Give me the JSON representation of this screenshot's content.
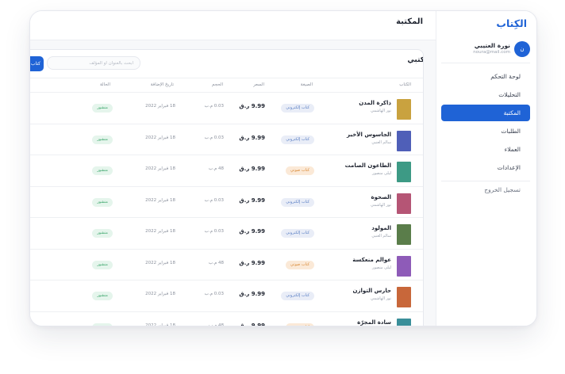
{
  "sidebar": {
    "logo": "الكِتاب",
    "profile": {
      "avatar_initial": "ن",
      "name": "نورة العتيبي",
      "email": "noura@mail.com"
    },
    "nav": [
      {
        "label": "لوحة التحكم",
        "active": false
      },
      {
        "label": "التحليلات",
        "active": false
      },
      {
        "label": "المكتبة",
        "active": true
      },
      {
        "label": "الطلبات",
        "active": false
      },
      {
        "label": "العملاء",
        "active": false
      },
      {
        "label": "الإعدادات",
        "active": false
      }
    ],
    "logout": "تسجيل الخروج"
  },
  "header": {
    "title": "المكتبة"
  },
  "library": {
    "title": "كتبي",
    "search_placeholder": "ابحث بالعنوان أو المؤلف",
    "add_button": "+ كتاب",
    "columns": {
      "book": "الكتاب",
      "format": "الصيغة",
      "price": "السعر",
      "size": "الحجم",
      "date": "تاريخ الإضافة",
      "status": "الحالة"
    },
    "rows": [
      {
        "title": "ذاكرة المدن",
        "author": "نور الهاشمي",
        "format": "كتاب إلكتروني",
        "format_type": "ebook",
        "price": "9.99 ر.ق",
        "size": "0.03 م.ب",
        "date": "18 فبراير 2022",
        "status": "منشور",
        "cover": "#c9a23f"
      },
      {
        "title": "الجاسوس الأخير",
        "author": "سالم العنبي",
        "format": "كتاب إلكتروني",
        "format_type": "ebook",
        "price": "9.99 ر.ق",
        "size": "0.03 م.ب",
        "date": "18 فبراير 2022",
        "status": "منشور",
        "cover": "#4f5fb8"
      },
      {
        "title": "الطاعون الصامت",
        "author": "ليلى منصور",
        "format": "كتاب صوتي",
        "format_type": "audio",
        "price": "9.99 ر.ق",
        "size": "48 م.ب",
        "date": "18 فبراير 2022",
        "status": "منشور",
        "cover": "#3d9a85"
      },
      {
        "title": "الصحوة",
        "author": "نور الهاشمي",
        "format": "كتاب إلكتروني",
        "format_type": "ebook",
        "price": "9.99 ر.ق",
        "size": "0.03 م.ب",
        "date": "18 فبراير 2022",
        "status": "منشور",
        "cover": "#b55575"
      },
      {
        "title": "المولود",
        "author": "سالم العنبي",
        "format": "كتاب إلكتروني",
        "format_type": "ebook",
        "price": "9.99 ر.ق",
        "size": "0.03 م.ب",
        "date": "18 فبراير 2022",
        "status": "منشور",
        "cover": "#5a7d4a"
      },
      {
        "title": "عوالم منعكسة",
        "author": "ليلى منصور",
        "format": "كتاب صوتي",
        "format_type": "audio",
        "price": "9.99 ر.ق",
        "size": "48 م.ب",
        "date": "18 فبراير 2022",
        "status": "منشور",
        "cover": "#8e5bb8"
      },
      {
        "title": "حارس التوازن",
        "author": "نور الهاشمي",
        "format": "كتاب إلكتروني",
        "format_type": "ebook",
        "price": "9.99 ر.ق",
        "size": "0.03 م.ب",
        "date": "18 فبراير 2022",
        "status": "منشور",
        "cover": "#c8673a"
      },
      {
        "title": "سادة المجرّة",
        "author": "سالم العنبي",
        "format": "كتاب صوتي",
        "format_type": "audio",
        "price": "9.99 ر.ق",
        "size": "48 م.ب",
        "date": "18 فبراير 2022",
        "status": "منشور",
        "cover": "#3a8f9a"
      }
    ]
  },
  "colors": {
    "accent": "#1f63d6",
    "ebook_badge_bg": "#e9edf7",
    "audio_badge_bg": "#fbe9d7",
    "status_badge_bg": "#e5f5ec",
    "status_text": "#3aa56a"
  }
}
